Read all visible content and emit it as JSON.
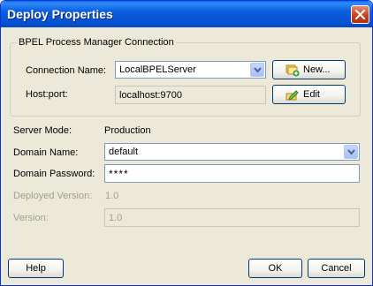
{
  "window": {
    "title": "Deploy Properties"
  },
  "group": {
    "title": "BPEL Process Manager Connection",
    "connection_name_label": "Connection Name:",
    "connection_name_value": "LocalBPELServer",
    "new_button": "New...",
    "host_port_label": "Host:port:",
    "host_port_value": "localhost:9700",
    "edit_button": "Edit"
  },
  "form": {
    "server_mode_label": "Server Mode:",
    "server_mode_value": "Production",
    "domain_name_label": "Domain Name:",
    "domain_name_value": "default",
    "domain_password_label": "Domain Password:",
    "domain_password_value": "****",
    "deployed_version_label": "Deployed Version:",
    "deployed_version_value": "1.0",
    "version_label": "Version:",
    "version_value": "1.0"
  },
  "buttons": {
    "help": "Help",
    "ok": "OK",
    "cancel": "Cancel"
  },
  "colors": {
    "title_bar": "#0755d6",
    "close": "#c9411f",
    "dialog_bg": "#ece9d8",
    "field_border": "#7f9db9"
  },
  "icons": {
    "close": "close-icon",
    "dropdown": "chevron-down-icon",
    "new": "new-connection-icon",
    "edit": "edit-pencil-icon"
  }
}
